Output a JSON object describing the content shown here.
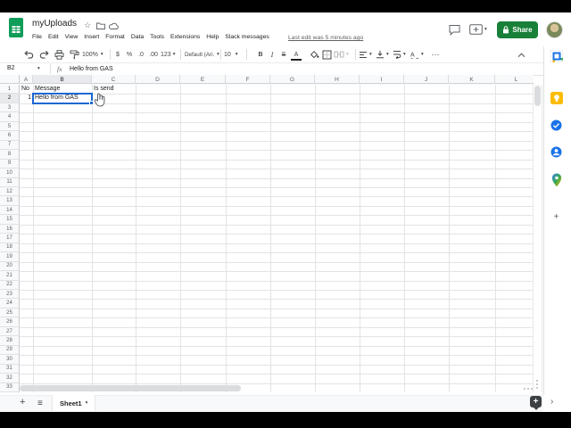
{
  "app": {
    "title": "myUploads",
    "menu_items": [
      "File",
      "Edit",
      "View",
      "Insert",
      "Format",
      "Data",
      "Tools",
      "Extensions",
      "Help",
      "Slack messages"
    ],
    "last_edit": "Last edit was 5 minutes ago",
    "share_label": "Share"
  },
  "toolbar": {
    "zoom_value": "100%",
    "currency": "$",
    "percent": "%",
    "decrease_decimal": ".0",
    "increase_decimal": ".00",
    "number_format": "123",
    "font_name": "Default (Ari...",
    "font_size": "10",
    "bold": "B",
    "italic": "I",
    "strikethrough": "S",
    "text_color": "A",
    "more": "⋯"
  },
  "formula_bar": {
    "cell_reference": "B2",
    "fx_label": "fx",
    "value": "Hello from GAS"
  },
  "grid": {
    "column_headers": [
      "A",
      "B",
      "C",
      "D",
      "E",
      "F",
      "G",
      "H",
      "I",
      "J",
      "K",
      "L"
    ],
    "row_count": 33,
    "selected_cell": "B2",
    "selected_column": "B",
    "selected_row": 2,
    "cells": [
      {
        "ref": "A1",
        "col": "A",
        "row": 1,
        "value": "No",
        "align": "left"
      },
      {
        "ref": "B1",
        "col": "B",
        "row": 1,
        "value": "Message",
        "align": "left"
      },
      {
        "ref": "C1",
        "col": "C",
        "row": 1,
        "value": "Is send",
        "align": "left"
      },
      {
        "ref": "A2",
        "col": "A",
        "row": 2,
        "value": "1",
        "align": "right"
      },
      {
        "ref": "B2",
        "col": "B",
        "row": 2,
        "value": "Hello from GAS",
        "align": "left",
        "selected": true
      }
    ]
  },
  "sheet_tabs": {
    "active_tab": "Sheet1"
  },
  "side_panel": {
    "icons": [
      "calendar",
      "keep",
      "tasks",
      "contacts",
      "maps",
      "add-addon"
    ]
  },
  "icons": {
    "star": "☆",
    "caret": "▾",
    "hamburger": "≡",
    "chevron_right": "›",
    "plus": "+",
    "more": "⋯"
  },
  "colors": {
    "brand_green": "#0f9d58",
    "share_green": "#188038",
    "selection_blue": "#1967d2",
    "link_gray": "#5f6368",
    "gridline": "#e3e3e3",
    "header_bg": "#f8f9fa"
  }
}
